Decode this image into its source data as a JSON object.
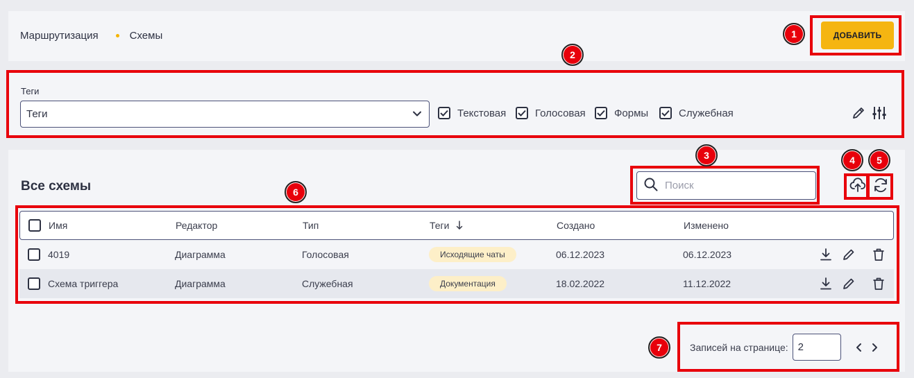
{
  "breadcrumb": {
    "root": "Маршрутизация",
    "current": "Схемы"
  },
  "header": {
    "add_button": "ДОБАВИТЬ"
  },
  "filters": {
    "tags_label": "Теги",
    "tags_value": "Теги",
    "types": [
      {
        "label": "Текстовая",
        "checked": true
      },
      {
        "label": "Голосовая",
        "checked": true
      },
      {
        "label": "Формы",
        "checked": true
      },
      {
        "label": "Служебная",
        "checked": true
      }
    ]
  },
  "main": {
    "title": "Все схемы",
    "search_placeholder": "Поиск",
    "columns": [
      "Имя",
      "Редактор",
      "Тип",
      "Теги",
      "Создано",
      "Изменено"
    ],
    "rows": [
      {
        "name": "4019",
        "editor": "Диаграмма",
        "type": "Голосовая",
        "tag": "Исходящие чаты",
        "created": "06.12.2023",
        "modified": "06.12.2023"
      },
      {
        "name": "Схема триггера",
        "editor": "Диаграмма",
        "type": "Служебная",
        "tag": "Документация",
        "created": "18.02.2022",
        "modified": "11.12.2022"
      }
    ]
  },
  "pagination": {
    "label": "Записей на странице:",
    "value": "2"
  },
  "markers": [
    "1",
    "2",
    "3",
    "4",
    "5",
    "6",
    "7"
  ],
  "colors": {
    "accent": "#f5b511",
    "highlight": "#e8000b",
    "badge": "#fdefc8"
  }
}
